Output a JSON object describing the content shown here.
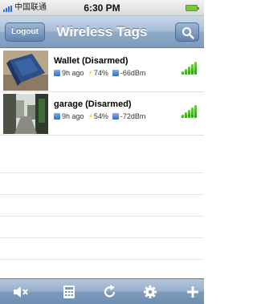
{
  "status_bar": {
    "carrier": "中国联通",
    "time": "6:30 PM"
  },
  "nav": {
    "title": "Wireless Tags",
    "logout_label": "Logout"
  },
  "tags": [
    {
      "name": "Wallet (Disarmed)",
      "last_seen": "9h ago",
      "battery": "74%",
      "signal": "-66dBm",
      "signal_level": 5
    },
    {
      "name": "garage (Disarmed)",
      "last_seen": "9h ago",
      "battery": "54%",
      "signal": "-72dBm",
      "signal_level": 5
    }
  ],
  "toolbar": {
    "buttons": [
      "mute-icon",
      "calculator-icon",
      "refresh-icon",
      "gear-icon",
      "add-icon"
    ]
  },
  "colors": {
    "nav_bar": "#8eaac8",
    "signal_green": "#3faa22",
    "battery_bolt": "#f2a800",
    "status_icon_blue": "#2f6cc3"
  }
}
